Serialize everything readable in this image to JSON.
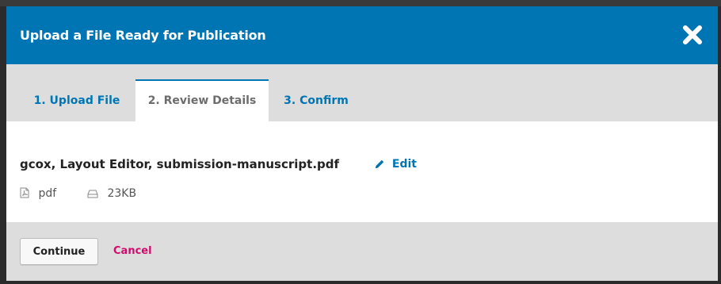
{
  "modal": {
    "title": "Upload a File Ready for Publication",
    "close_icon": "close-icon"
  },
  "tabs": [
    {
      "label": "1. Upload File",
      "active": false
    },
    {
      "label": "2. Review Details",
      "active": true
    },
    {
      "label": "3. Confirm",
      "active": false
    }
  ],
  "file": {
    "title": "gcox, Layout Editor, submission-manuscript.pdf",
    "edit_label": "Edit",
    "type": "pdf",
    "size": "23KB"
  },
  "footer": {
    "continue_label": "Continue",
    "cancel_label": "Cancel"
  },
  "colors": {
    "header_bg": "#0075b4",
    "link": "#0075b4",
    "cancel": "#d00a6c",
    "tab_bar_bg": "#dddddd"
  }
}
